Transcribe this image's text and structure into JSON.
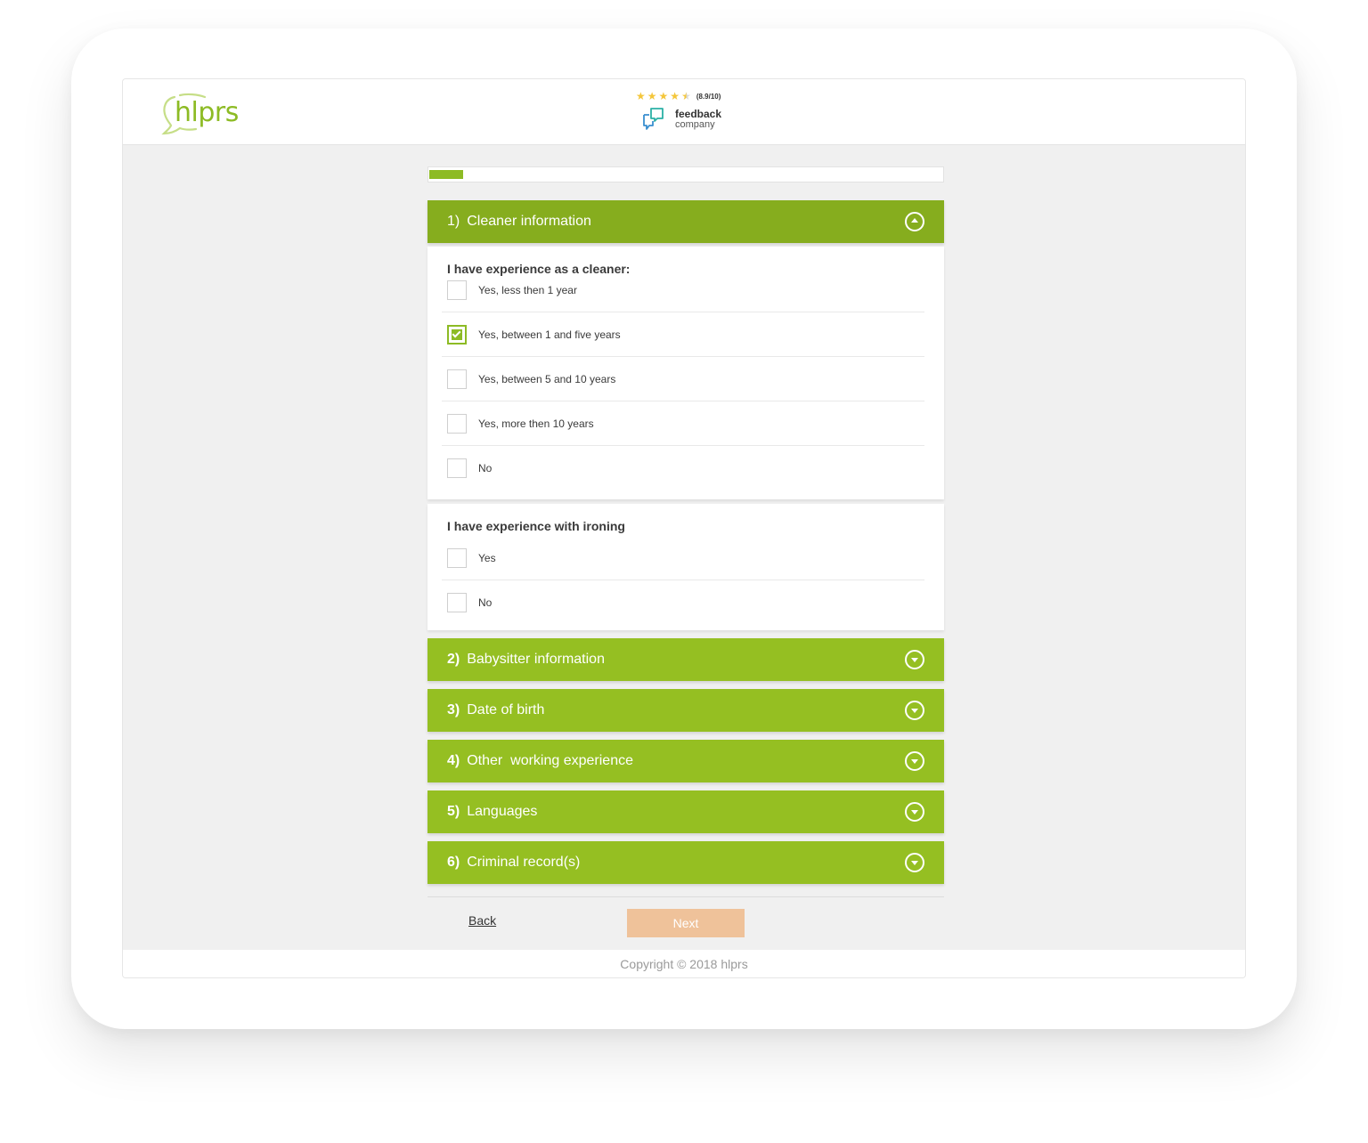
{
  "brand": {
    "logo_text": "hlprs",
    "accent_color": "#8dbb24"
  },
  "rating": {
    "stars": 4.5,
    "score_text": "(8.9/10)",
    "provider_line1": "feedback",
    "provider_line2": "company"
  },
  "progress": {
    "percent": 6.5
  },
  "sections": [
    {
      "number": "1)",
      "title": "Cleaner information",
      "expanded": true
    },
    {
      "number": "2)",
      "title": "Babysitter information",
      "expanded": false
    },
    {
      "number": "3)",
      "title": "Date of birth",
      "expanded": false
    },
    {
      "number": "4)",
      "title": "Other  working experience",
      "expanded": false
    },
    {
      "number": "5)",
      "title": "Languages",
      "expanded": false
    },
    {
      "number": "6)",
      "title": "Criminal record(s)",
      "expanded": false
    }
  ],
  "questions": [
    {
      "title": "I have experience as a cleaner:",
      "options": [
        {
          "label": "Yes, less then 1 year",
          "checked": false
        },
        {
          "label": "Yes, between 1 and five years",
          "checked": true
        },
        {
          "label": "Yes, between 5 and 10 years",
          "checked": false
        },
        {
          "label": "Yes, more then 10 years",
          "checked": false
        },
        {
          "label": "No",
          "checked": false
        }
      ]
    },
    {
      "title": "I have experience with ironing",
      "options": [
        {
          "label": "Yes",
          "checked": false
        },
        {
          "label": "No",
          "checked": false
        }
      ]
    }
  ],
  "nav": {
    "back_label": "Back",
    "next_label": "Next"
  },
  "footer": {
    "copyright": "Copyright © 2018 hlprs"
  },
  "colors": {
    "section_header": "#95bf22",
    "section_header_open": "#86ad1e",
    "next_button": "#efc29a",
    "star": "#f4c63a"
  }
}
